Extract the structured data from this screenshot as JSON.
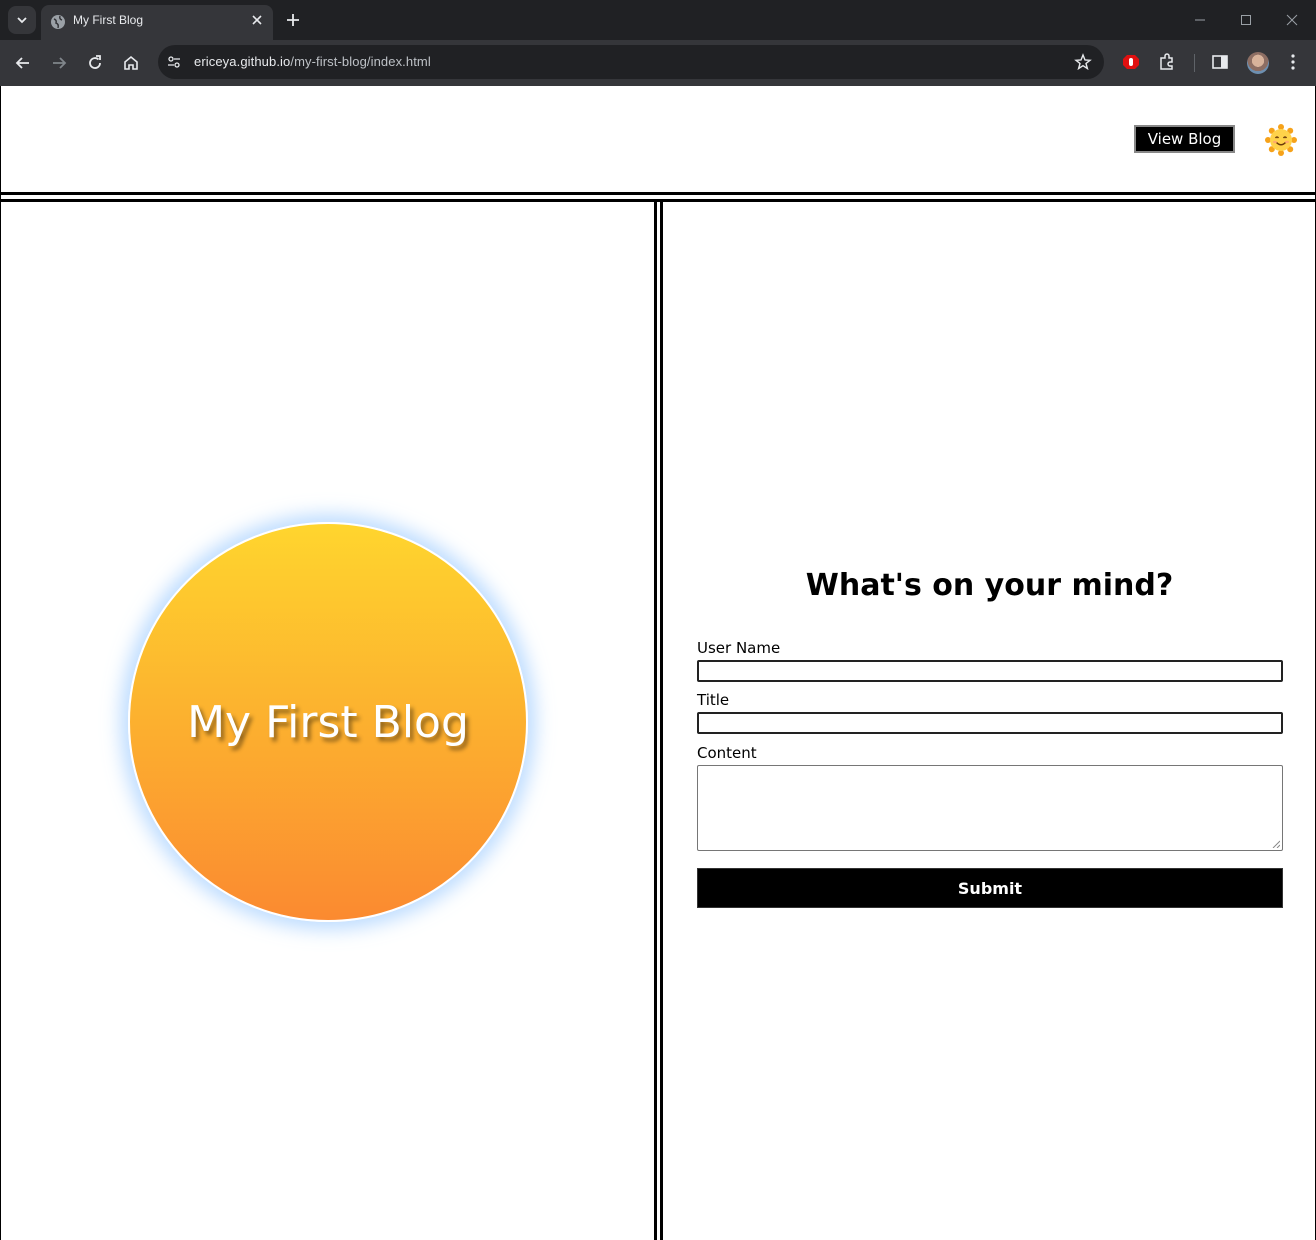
{
  "browser": {
    "tab": {
      "title": "My First Blog",
      "favicon": "globe-icon"
    },
    "address_bar": {
      "host": "ericeya.github.io",
      "path": "/my-first-blog/index.html"
    },
    "icons": [
      "back-icon",
      "forward-icon",
      "reload-icon",
      "home-icon",
      "site-settings-icon",
      "bookmark-star-icon",
      "extension-icon",
      "puzzle-icon",
      "side-panel-icon",
      "profile-avatar",
      "menu-icon"
    ]
  },
  "header": {
    "view_blog_label": "View Blog",
    "theme_toggle": "smiling-sun-emoji"
  },
  "hero": {
    "title": "My First Blog"
  },
  "form": {
    "heading": "What's on your mind?",
    "username_label": "User Name",
    "username_value": "",
    "title_label": "Title",
    "title_value": "",
    "content_label": "Content",
    "content_value": "",
    "submit_label": "Submit"
  },
  "colors": {
    "sun_top": "#ffd52e",
    "sun_bottom": "#fb8a30",
    "glow": "#aad2ff",
    "button_bg": "#000000"
  }
}
